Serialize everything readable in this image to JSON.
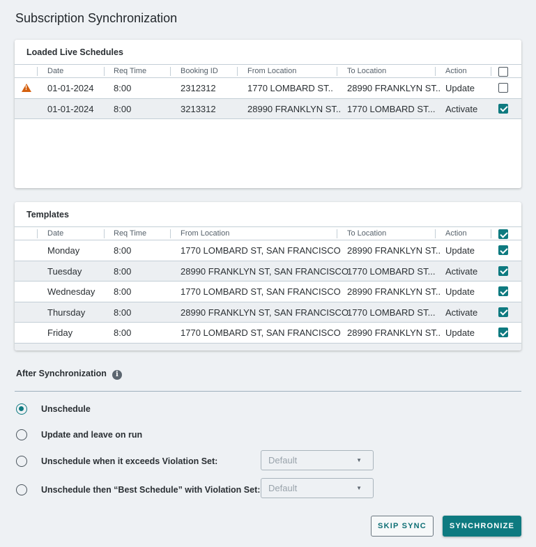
{
  "title": "Subscription Synchronization",
  "colors": {
    "accent": "#0e7a80",
    "warning": "#d4600f"
  },
  "live": {
    "title": "Loaded Live Schedules",
    "headers": [
      "Date",
      "Req Time",
      "Booking ID",
      "From Location",
      "To Location",
      "Action"
    ],
    "header_checked": false,
    "rows": [
      {
        "warning": true,
        "date": "01-01-2024",
        "time": "8:00",
        "id": "2312312",
        "from": "1770 LOMBARD ST..",
        "to": "28990 FRANKLYN ST..",
        "action": "Update",
        "checked": false
      },
      {
        "warning": false,
        "date": "01-01-2024",
        "time": "8:00",
        "id": "3213312",
        "from": "28990 FRANKLYN ST..",
        "to": "1770 LOMBARD ST...",
        "action": "Activate",
        "checked": true
      }
    ]
  },
  "templates": {
    "title": "Templates",
    "headers": [
      "Date",
      "Req Time",
      "From Location",
      "To Location",
      "Action"
    ],
    "header_checked": true,
    "rows": [
      {
        "date": "Monday",
        "time": "8:00",
        "from": "1770 LOMBARD ST, SAN FRANCISCO",
        "to": "28990 FRANKLYN ST..",
        "action": "Update",
        "checked": true
      },
      {
        "date": "Tuesday",
        "time": "8:00",
        "from": "28990 FRANKLYN ST, SAN FRANCISCO",
        "to": "1770 LOMBARD ST...",
        "action": "Activate",
        "checked": true
      },
      {
        "date": "Wednesday",
        "time": "8:00",
        "from": "1770 LOMBARD ST, SAN FRANCISCO",
        "to": "28990 FRANKLYN ST..",
        "action": "Update",
        "checked": true
      },
      {
        "date": "Thursday",
        "time": "8:00",
        "from": "28990 FRANKLYN ST, SAN FRANCISCO",
        "to": "1770 LOMBARD ST...",
        "action": "Activate",
        "checked": true
      },
      {
        "date": "Friday",
        "time": "8:00",
        "from": "1770 LOMBARD ST, SAN FRANCISCO",
        "to": "28990 FRANKLYN ST..",
        "action": "Update",
        "checked": true
      }
    ]
  },
  "after": {
    "title": "After Synchronization",
    "info_icon": "i",
    "options": [
      {
        "label": "Unschedule",
        "selected": true
      },
      {
        "label": "Update and leave on run",
        "selected": false
      },
      {
        "label": "Unschedule when it exceeds Violation Set:",
        "selected": false,
        "select": "Default"
      },
      {
        "label": "Unschedule then “Best Schedule” with Violation Set:",
        "selected": false,
        "select": "Default"
      }
    ]
  },
  "buttons": {
    "skip": "SKIP SYNC",
    "sync": "SYNCHRONIZE"
  }
}
